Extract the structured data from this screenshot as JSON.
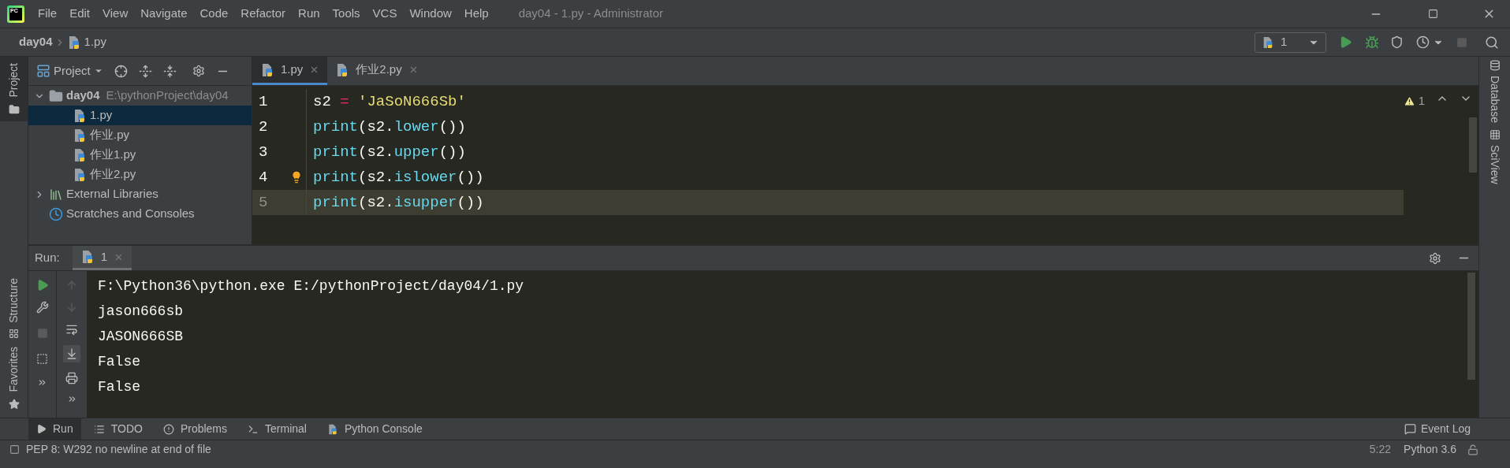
{
  "window": {
    "logo": "PC",
    "menu": [
      "File",
      "Edit",
      "View",
      "Navigate",
      "Code",
      "Refactor",
      "Run",
      "Tools",
      "VCS",
      "Window",
      "Help"
    ],
    "title": "day04 - 1.py - Administrator"
  },
  "breadcrumb": [
    "day04",
    "1.py"
  ],
  "run_config": {
    "label": "1"
  },
  "left_strip_top": [
    {
      "label": "Project",
      "selected": true
    }
  ],
  "left_strip_bottom": [
    {
      "label": "Structure",
      "kind": "structure"
    },
    {
      "label": "Favorites",
      "kind": "favorites"
    }
  ],
  "project_panel": {
    "title": "Project",
    "tree": [
      {
        "label": "day04",
        "path": "E:\\pythonProject\\day04",
        "kind": "folder",
        "expanded": true,
        "selected": false,
        "children": [
          {
            "label": "1.py",
            "kind": "python",
            "selected": true
          },
          {
            "label": "作业.py",
            "kind": "python",
            "selected": false
          },
          {
            "label": "作业1.py",
            "kind": "python",
            "selected": false
          },
          {
            "label": "作业2.py",
            "kind": "python",
            "selected": false
          }
        ]
      },
      {
        "label": "External Libraries",
        "kind": "libraries",
        "expanded": false,
        "selected": false
      },
      {
        "label": "Scratches and Consoles",
        "kind": "scratches",
        "selected": false
      }
    ]
  },
  "editor": {
    "tabs": [
      {
        "label": "1.py",
        "selected": true
      },
      {
        "label": "作业2.py",
        "selected": false
      }
    ],
    "warnings": "1",
    "lines": [
      {
        "number": "1",
        "current": false,
        "bulb": false,
        "tokens": [
          {
            "kind": "name",
            "text": "s2 "
          },
          {
            "kind": "op",
            "text": "="
          },
          {
            "kind": "string",
            "text": " 'JaSoN666Sb'"
          }
        ]
      },
      {
        "number": "2",
        "current": false,
        "bulb": false,
        "tokens": [
          {
            "kind": "builtin",
            "text": "print"
          },
          {
            "kind": "punct",
            "text": "("
          },
          {
            "kind": "name",
            "text": "s2"
          },
          {
            "kind": "punct",
            "text": "."
          },
          {
            "kind": "builtin",
            "text": "lower"
          },
          {
            "kind": "punct",
            "text": "())"
          }
        ]
      },
      {
        "number": "3",
        "current": false,
        "bulb": false,
        "tokens": [
          {
            "kind": "builtin",
            "text": "print"
          },
          {
            "kind": "punct",
            "text": "("
          },
          {
            "kind": "name",
            "text": "s2"
          },
          {
            "kind": "punct",
            "text": "."
          },
          {
            "kind": "builtin",
            "text": "upper"
          },
          {
            "kind": "punct",
            "text": "())"
          }
        ]
      },
      {
        "number": "4",
        "current": false,
        "bulb": true,
        "tokens": [
          {
            "kind": "builtin",
            "text": "print"
          },
          {
            "kind": "punct",
            "text": "("
          },
          {
            "kind": "name",
            "text": "s2"
          },
          {
            "kind": "punct",
            "text": "."
          },
          {
            "kind": "builtin",
            "text": "islower"
          },
          {
            "kind": "punct",
            "text": "())"
          }
        ]
      },
      {
        "number": "5",
        "current": true,
        "bulb": false,
        "tokens": [
          {
            "kind": "builtin",
            "text": "print"
          },
          {
            "kind": "punct",
            "text": "("
          },
          {
            "kind": "name",
            "text": "s2"
          },
          {
            "kind": "punct",
            "text": "."
          },
          {
            "kind": "builtin",
            "text": "isupper"
          },
          {
            "kind": "punct",
            "text": "())"
          }
        ]
      }
    ]
  },
  "right_strip": [
    "Database",
    "SciView"
  ],
  "run_panel": {
    "title": "Run:",
    "tabs": [
      {
        "label": "1",
        "selected": true
      }
    ],
    "output": [
      "F:\\Python36\\python.exe E:/pythonProject/day04/1.py",
      "jason666sb",
      "JASON666SB",
      "False",
      "False"
    ]
  },
  "bottom_tabs": [
    {
      "label": "Run",
      "kind": "run",
      "selected": true
    },
    {
      "label": "TODO",
      "kind": "todo",
      "selected": false
    },
    {
      "label": "Problems",
      "kind": "problems",
      "selected": false
    },
    {
      "label": "Terminal",
      "kind": "terminal",
      "selected": false
    },
    {
      "label": "Python Console",
      "kind": "console",
      "selected": false
    }
  ],
  "event_log": "Event Log",
  "status_bar": {
    "message": "PEP 8: W292 no newline at end of file",
    "position": "5:22",
    "interpreter": "Python 3.6"
  }
}
